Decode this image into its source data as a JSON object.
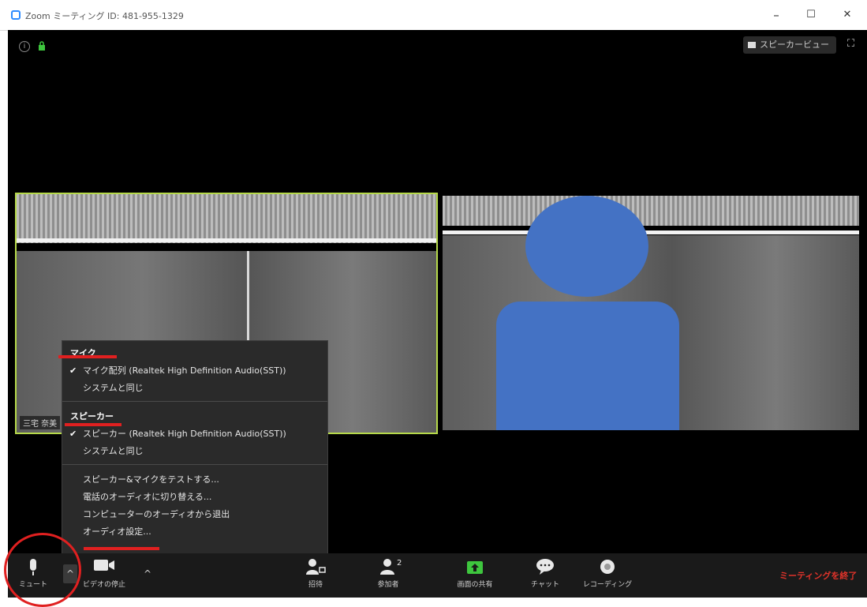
{
  "window": {
    "title": "Zoom ミーティング ID: 481-955-1329",
    "minimize": "–",
    "maximize": "☐",
    "close": "✕"
  },
  "stage": {
    "speaker_view_label": "スピーカービュー",
    "fullscreen_symbol": "⛶",
    "info_symbol": "i",
    "lock_symbol": "🔒"
  },
  "videos": [
    {
      "name": "三宅 奈美"
    },
    {
      "name": ""
    }
  ],
  "audio_menu": {
    "mic_header": "マイク",
    "mic_items": [
      {
        "label": "マイク配列 (Realtek High Definition Audio(SST))",
        "checked": true
      },
      {
        "label": "システムと同じ",
        "checked": false
      }
    ],
    "speaker_header": "スピーカー",
    "speaker_items": [
      {
        "label": "スピーカー (Realtek High Definition Audio(SST))",
        "checked": true
      },
      {
        "label": "システムと同じ",
        "checked": false
      }
    ],
    "actions": [
      "スピーカー&マイクをテストする...",
      "電話のオーディオに切り替える...",
      "コンピューターのオーディオから退出",
      "オーディオ設定..."
    ],
    "check_mark": "✔"
  },
  "toolbar": {
    "mute_label": "ミュート",
    "video_label": "ビデオの停止",
    "invite_label": "招待",
    "participants_label": "参加者",
    "participants_count": "2",
    "share_label": "画面の共有",
    "chat_label": "チャット",
    "record_label": "レコーディング",
    "end_label": "ミーティングを終了",
    "caret": "^"
  },
  "colors": {
    "accent_red": "#e02020",
    "zoom_blue": "#2d8cff",
    "active_speaker_border": "#b6d94a",
    "avatar_blue": "#4472c4",
    "share_green": "#3ec63e"
  }
}
